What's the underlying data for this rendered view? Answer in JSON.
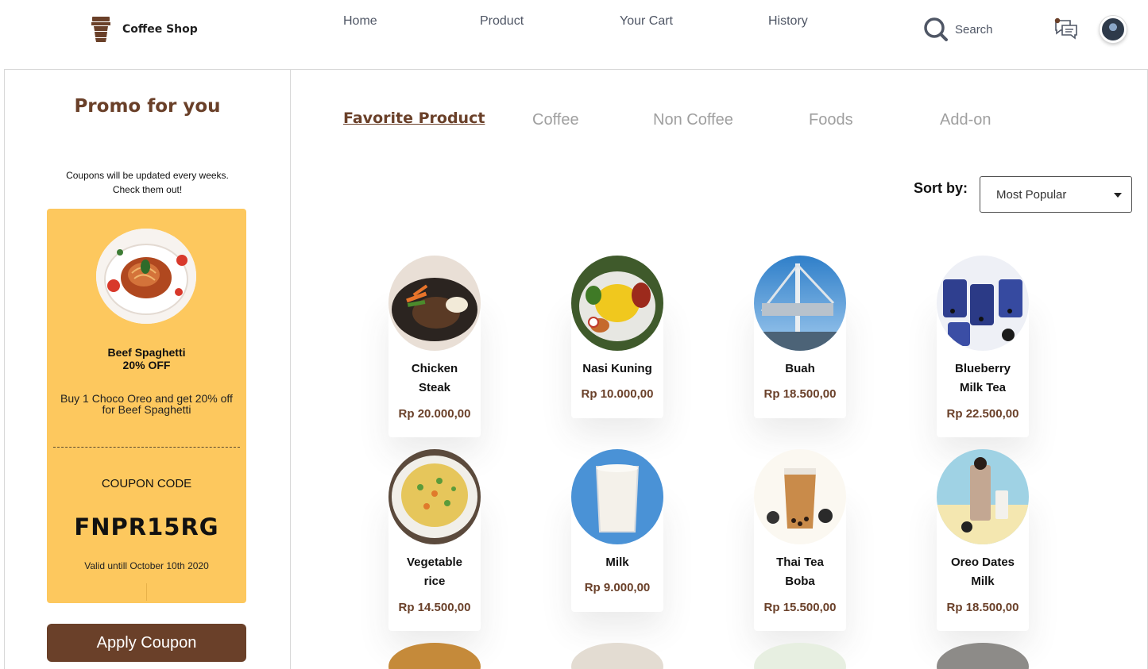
{
  "header": {
    "brand": "Coffee Shop",
    "nav": [
      {
        "label": "Home"
      },
      {
        "label": "Product"
      },
      {
        "label": "Your Cart"
      },
      {
        "label": "History"
      }
    ],
    "search_label": "Search"
  },
  "promo": {
    "title": "Promo for you",
    "desc_line1": "Coupons will be updated every weeks.",
    "desc_line2": "Check them out!",
    "coupon": {
      "name_line1": "Beef Spaghetti",
      "name_line2": "20% OFF",
      "desc_line1": "Buy 1 Choco Oreo and get 20% off",
      "desc_line2": "for Beef Spaghetti",
      "code_label": "COUPON CODE",
      "code": "FNPR15RG",
      "valid": "Valid untill October 10th 2020"
    },
    "apply_label": "Apply Coupon"
  },
  "tabs": [
    {
      "label": "Favorite Product",
      "active": true
    },
    {
      "label": "Coffee"
    },
    {
      "label": "Non Coffee"
    },
    {
      "label": "Foods"
    },
    {
      "label": "Add-on"
    }
  ],
  "sort": {
    "label": "Sort by:",
    "value": "Most Popular"
  },
  "products": [
    {
      "name_line1": "Chicken",
      "name_line2": "Steak",
      "price": "Rp 20.000,00",
      "icon": "steak-image"
    },
    {
      "name_line1": "Nasi Kuning",
      "name_line2": "",
      "price": "Rp 10.000,00",
      "icon": "nasi-kuning-image"
    },
    {
      "name_line1": "Buah",
      "name_line2": "",
      "price": "Rp 18.500,00",
      "icon": "crane-image"
    },
    {
      "name_line1": "Blueberry",
      "name_line2": "Milk Tea",
      "price": "Rp 22.500,00",
      "icon": "blueberry-tea-image"
    },
    {
      "name_line1": "Vegetable",
      "name_line2": "rice",
      "price": "Rp 14.500,00",
      "icon": "fried-rice-image"
    },
    {
      "name_line1": "Milk",
      "name_line2": "",
      "price": "Rp 9.000,00",
      "icon": "milk-image"
    },
    {
      "name_line1": "Thai Tea",
      "name_line2": "Boba",
      "price": "Rp 15.500,00",
      "icon": "thai-tea-image"
    },
    {
      "name_line1": "Oreo Dates",
      "name_line2": "Milk",
      "price": "Rp 18.500,00",
      "icon": "oreo-milk-image"
    }
  ],
  "colors": {
    "brand_brown": "#6a4029",
    "coupon_yellow": "#fdc85e",
    "nav_text": "#4f5665"
  }
}
